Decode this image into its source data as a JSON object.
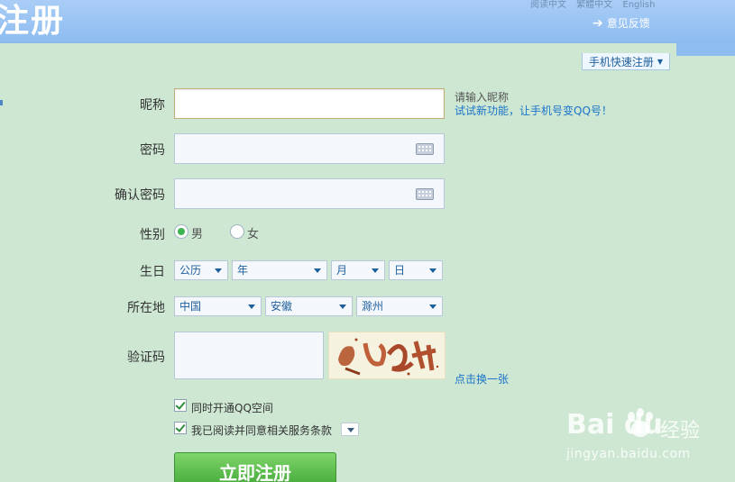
{
  "header": {
    "title": "注册",
    "top_links": [
      "阅读中文",
      "繁體中文",
      "English"
    ],
    "feedback_label": "意见反馈"
  },
  "mobile_register_label": "手机快速注册",
  "form": {
    "nickname": {
      "label": "昵称",
      "value": "",
      "hint": "请输入昵称",
      "hint_link": "试试新功能，让手机号变QQ号！"
    },
    "password": {
      "label": "密码",
      "value": ""
    },
    "confirm_password": {
      "label": "确认密码",
      "value": ""
    },
    "gender": {
      "label": "性别",
      "options": [
        "男",
        "女"
      ],
      "selected": "男"
    },
    "birthday": {
      "label": "生日",
      "calendar": "公历",
      "year": "年",
      "month": "月",
      "day": "日"
    },
    "location": {
      "label": "所在地",
      "country": "中国",
      "province": "安徽",
      "city": "滁州"
    },
    "captcha": {
      "label": "验证码",
      "value": "",
      "refresh_link": "点击换一张"
    },
    "options": {
      "qzone_label": "同时开通QQ空间",
      "qzone_checked": true,
      "terms_label": "我已阅读并同意相关服务条款",
      "terms_checked": true
    },
    "submit_label": "立即注册"
  },
  "watermark": {
    "logo": "Bai du",
    "cn": "经验",
    "url": "jingyan.baidu.com"
  },
  "colors": {
    "background": "#cde7d2",
    "header": "#8dbcf0",
    "link": "#1b73c9",
    "submit": "#43a737"
  }
}
